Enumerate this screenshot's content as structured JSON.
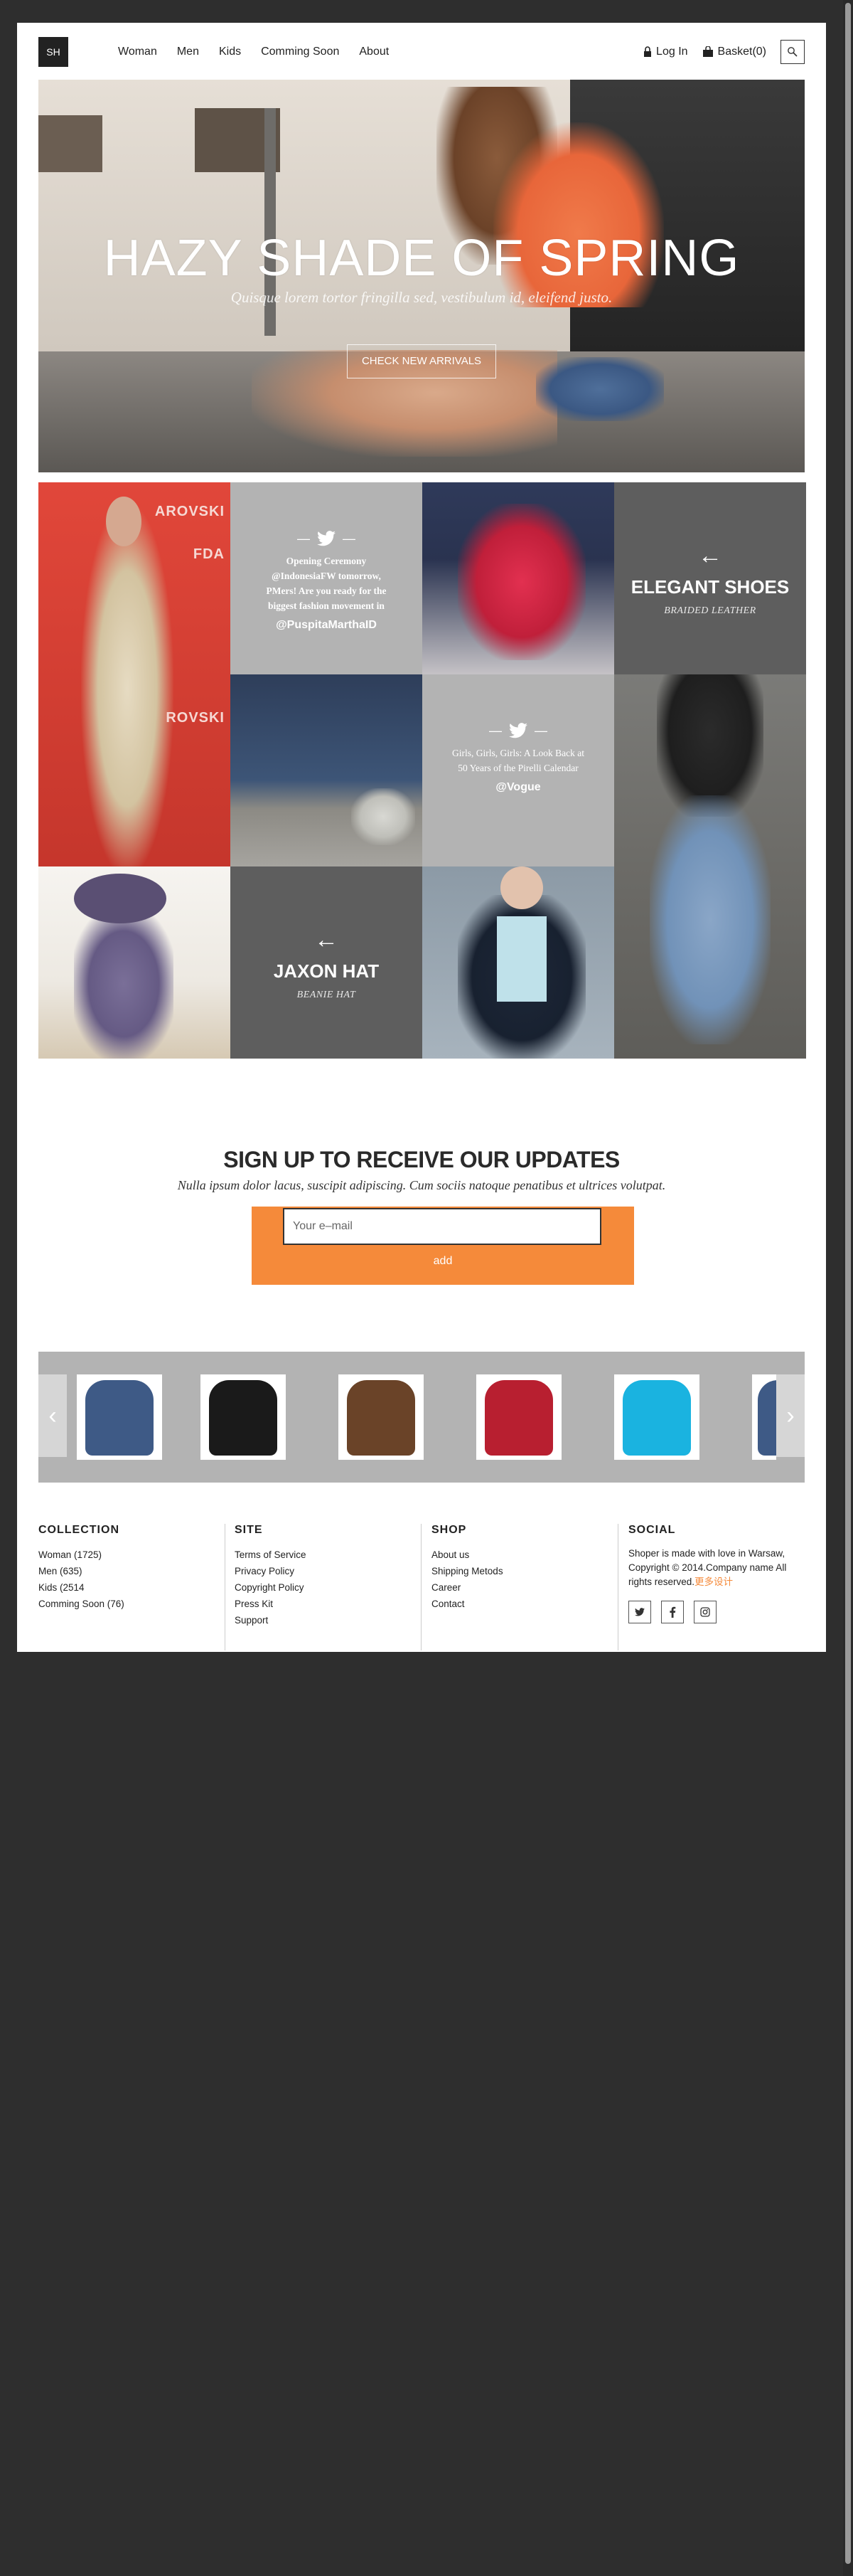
{
  "header": {
    "logo": "SH",
    "nav": [
      "Woman",
      "Men",
      "Kids",
      "Comming Soon",
      "About"
    ],
    "login": "Log In",
    "basket": "Basket(0)"
  },
  "hero": {
    "title": "HAZY SHADE OF SPRING",
    "subtitle": "Quisque lorem tortor fringilla sed, vestibulum id, eleifend justo.",
    "cta": "CHECK NEW ARRIVALS"
  },
  "grid": {
    "tweet1": {
      "text": "Opening Ceremony @IndonesiaFW tomorrow, PMers! Are you ready for the biggest fashion movement in",
      "handle": "@PuspitaMarthaID"
    },
    "tweet2": {
      "text": "Girls, Girls, Girls: A Look Back at 50 Years of the Pirelli Calendar",
      "handle": "@Vogue"
    },
    "promo1": {
      "arrow": "←",
      "title": "ELEGANT SHOES",
      "subtitle": "BRAIDED LEATHER"
    },
    "promo2": {
      "arrow": "←",
      "title": "JAXON HAT",
      "subtitle": "BEANIE HAT"
    },
    "photo_text": [
      "AROVSKI",
      "FDA",
      "ROVSKI"
    ]
  },
  "signup": {
    "title": "SIGN UP TO RECEIVE OUR UPDATES",
    "subtitle": "Nulla ipsum dolor lacus, suscipit adipiscing. Cum sociis natoque penatibus et ultrices volutpat.",
    "placeholder": "Your e–mail",
    "button": "add"
  },
  "carousel": {
    "prev": "‹",
    "next": "›",
    "colors": [
      "#3e5a86",
      "#1a1a1a",
      "#6a4328",
      "#b81f30",
      "#1ab3e0",
      "#3e5a86"
    ]
  },
  "footer": {
    "collection": {
      "title": "COLLECTION",
      "items": [
        "Woman (1725)",
        "Men (635)",
        "Kids (2514",
        "Comming Soon (76)"
      ]
    },
    "site": {
      "title": "SITE",
      "items": [
        "Terms of Service",
        "Privacy Policy",
        "Copyright Policy",
        "Press Kit",
        "Support"
      ]
    },
    "shop": {
      "title": "SHOP",
      "items": [
        "About us",
        "Shipping Metods",
        "Career",
        "Contact"
      ]
    },
    "social": {
      "title": "SOCIAL",
      "text": "Shoper is made with love in Warsaw, Copyright © 2014.Company name All rights reserved.",
      "highlight": "更多设计",
      "icons": [
        "twitter-icon",
        "facebook-icon",
        "instagram-icon"
      ]
    }
  }
}
